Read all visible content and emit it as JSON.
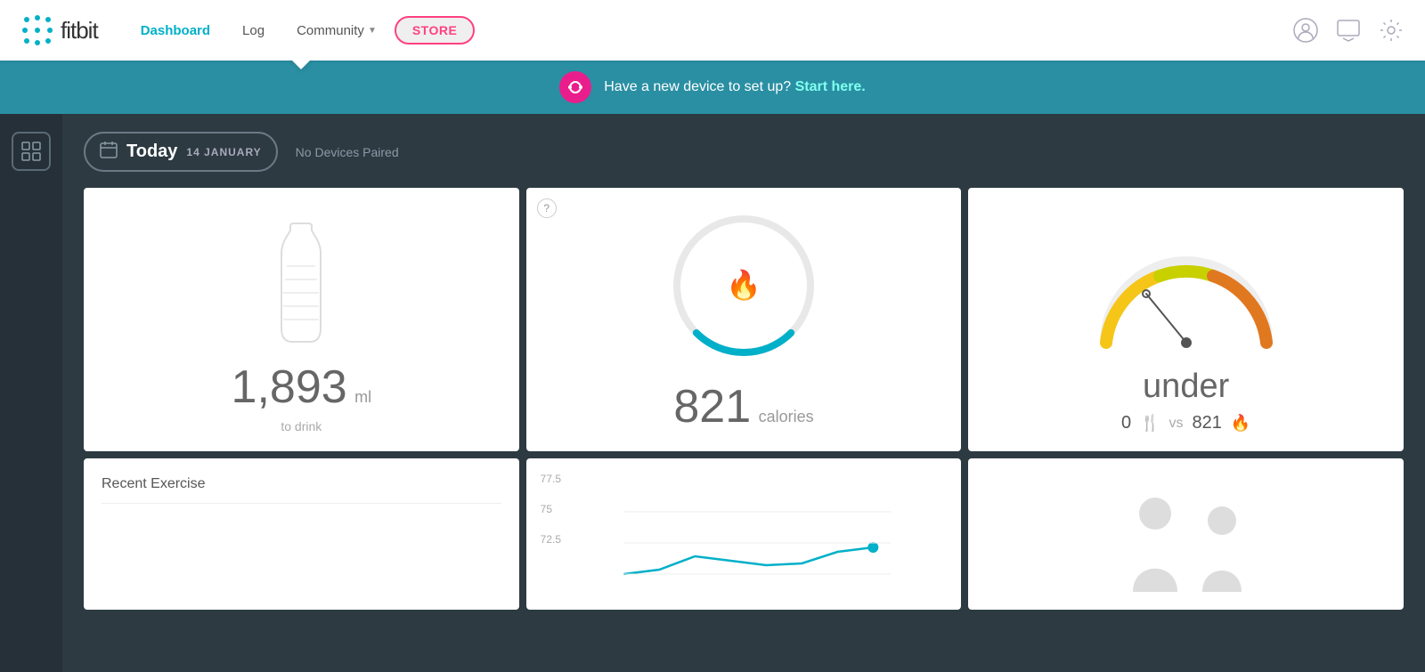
{
  "navbar": {
    "logo_text": "fitbit",
    "nav_dashboard": "Dashboard",
    "nav_log": "Log",
    "nav_community": "Community",
    "nav_store": "STORE"
  },
  "banner": {
    "text": "Have a new device to set up?",
    "link_text": "Start here."
  },
  "date_header": {
    "today_label": "Today",
    "date_sub": "14 JANUARY",
    "no_devices": "No Devices Paired",
    "calendar_icon": "📅"
  },
  "water_card": {
    "value": "1,893",
    "unit": "ml",
    "label": "to drink"
  },
  "calories_card": {
    "value": "821",
    "unit": "calories",
    "ring_progress": 0.25
  },
  "gauge_card": {
    "label": "under",
    "food_value": "0",
    "vs_label": "vs",
    "burned_value": "821"
  },
  "exercise_card": {
    "title": "Recent Exercise"
  },
  "chart_card": {
    "label1": "77.5",
    "label2": "75",
    "label3": "72.5"
  }
}
